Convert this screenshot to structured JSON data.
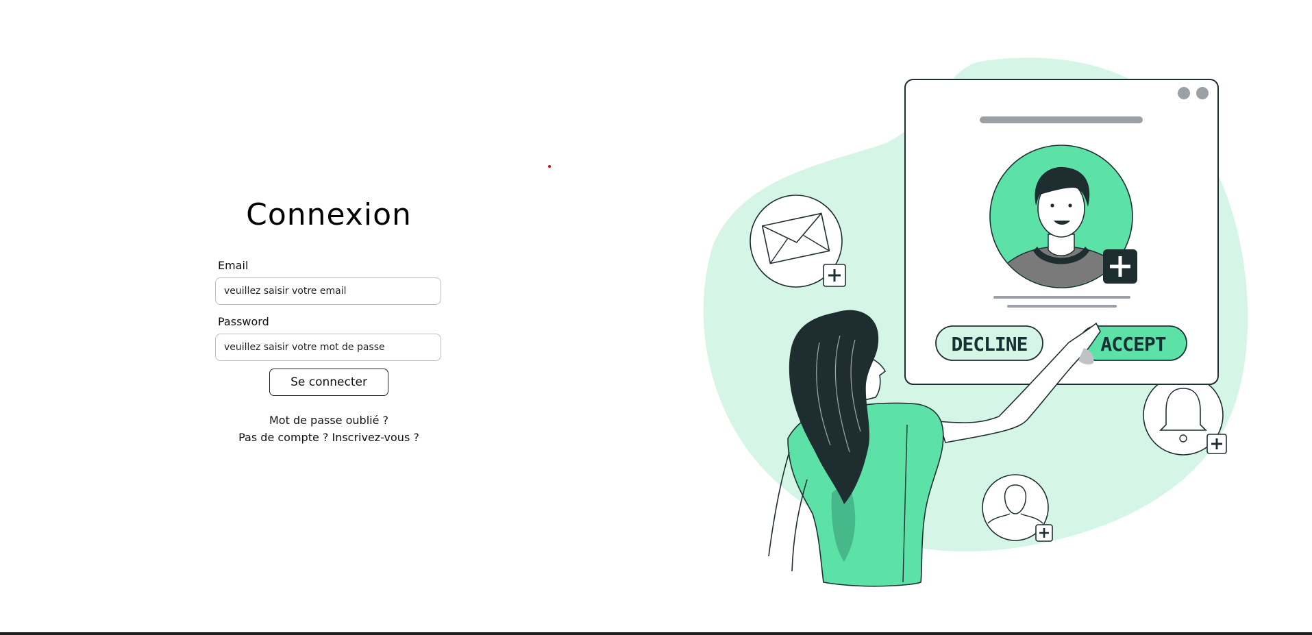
{
  "login": {
    "title": "Connexion",
    "email_label": "Email",
    "email_placeholder": "veuillez saisir votre email",
    "password_label": "Password",
    "password_placeholder": "veuillez saisir votre mot de passe",
    "submit_label": "Se connecter",
    "forgot_password_link": "Mot de passe oublié ?",
    "signup_link": "Pas de compte ? Inscrivez-vous ?"
  },
  "illustration": {
    "decline_label": "DECLINE",
    "accept_label": "ACCEPT",
    "colors": {
      "accent_green": "#5ce1a6",
      "light_green_blob": "#d5f6e6",
      "dark_outline": "#1e2d30",
      "gray": "#9aa0a3"
    },
    "icons": [
      "envelope-icon",
      "bell-icon",
      "user-outline-icon",
      "plus-icon"
    ]
  }
}
